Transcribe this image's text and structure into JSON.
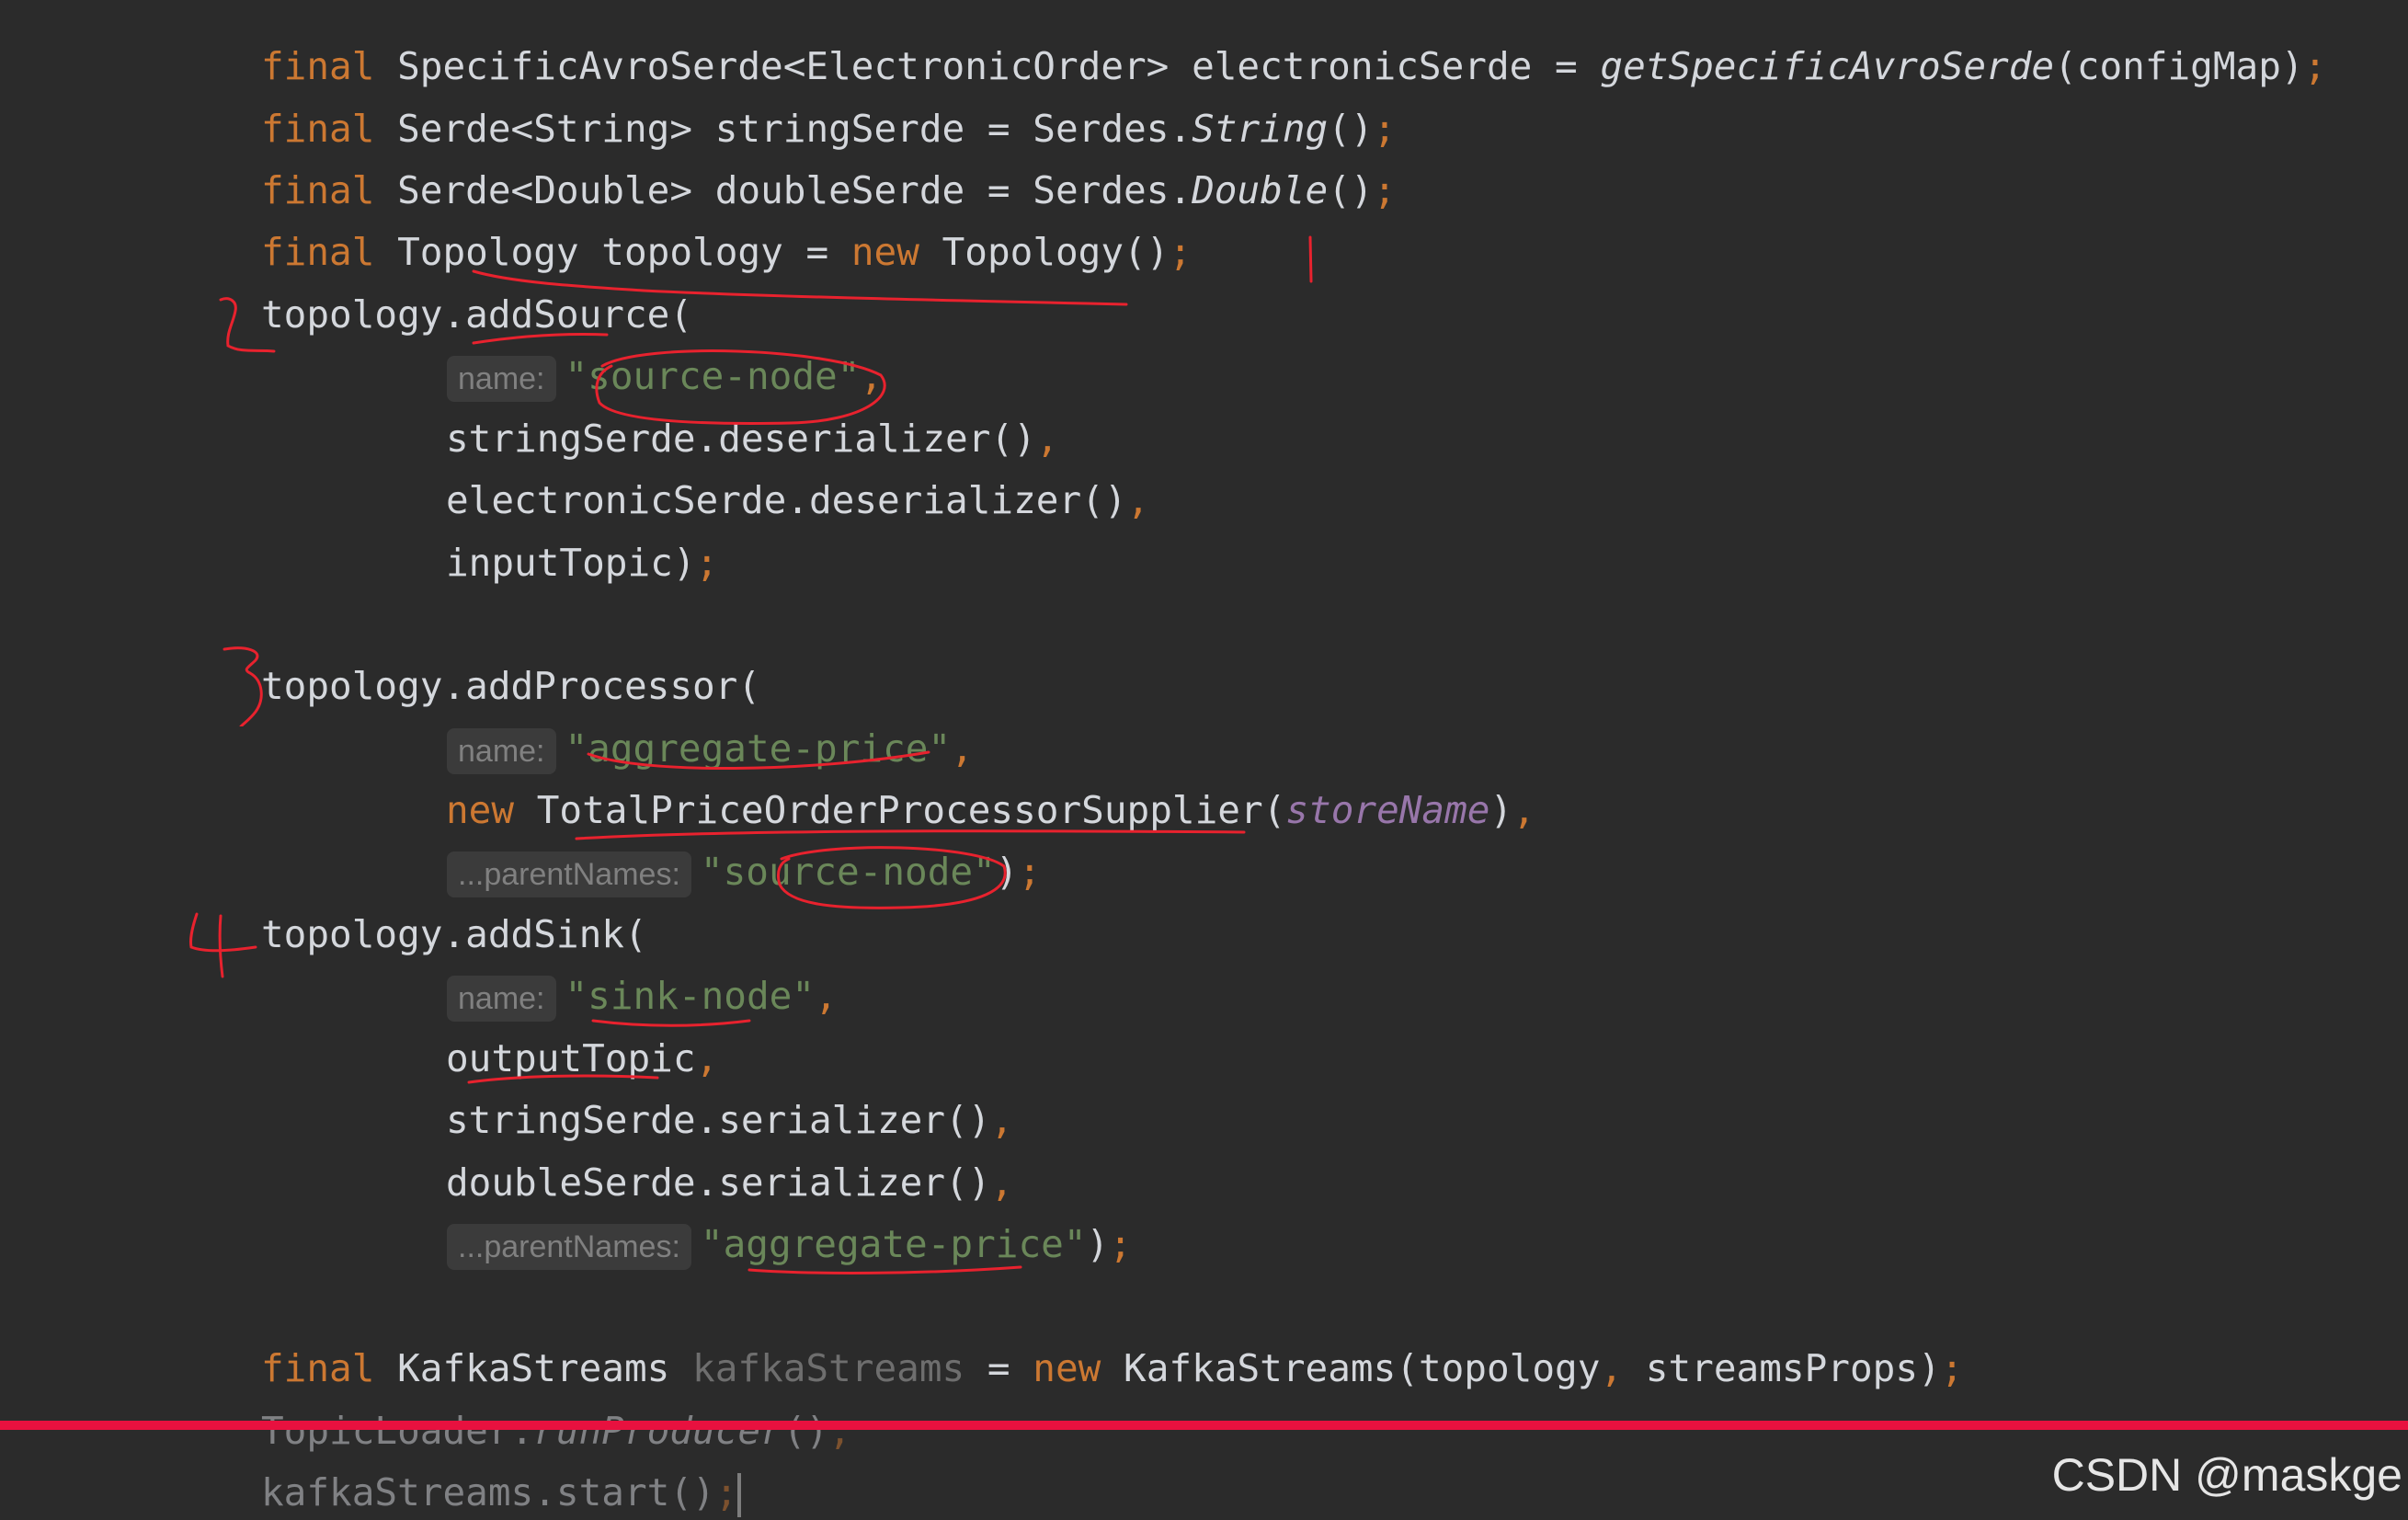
{
  "code": {
    "l1": {
      "kw": "final",
      "type": "SpecificAvroSerde<ElectronicOrder>",
      "var": "electronicSerde",
      "eq": "=",
      "call": "getSpecificAvroSerde",
      "args": "(configMap)",
      "end": ";"
    },
    "l2": {
      "kw": "final",
      "type": "Serde<String>",
      "var": "stringSerde",
      "eq": "=",
      "obj": "Serdes.",
      "call": "String",
      "args": "()",
      "end": ";"
    },
    "l3": {
      "kw": "final",
      "type": "Serde<Double>",
      "var": "doubleSerde",
      "eq": "=",
      "obj": "Serdes.",
      "call": "Double",
      "args": "()",
      "end": ";"
    },
    "l4": {
      "kw": "final",
      "type": "Topology",
      "var": "topology",
      "eq": "=",
      "kw2": "new",
      "call": "Topology()",
      "end": ";"
    },
    "l5": {
      "text": "topology.addSource("
    },
    "l6": {
      "hint": "name:",
      "str": "\"source-node\"",
      "end": ","
    },
    "l7": {
      "text": "stringSerde.deserializer()",
      "end": ","
    },
    "l8": {
      "text": "electronicSerde.deserializer()",
      "end": ","
    },
    "l9": {
      "text": "inputTopic)",
      "end": ";"
    },
    "l10": {
      "text": "topology.addProcessor("
    },
    "l11": {
      "hint": "name:",
      "str": "\"aggregate-price\"",
      "end": ","
    },
    "l12": {
      "kw": "new",
      "call": "TotalPriceOrderProcessorSupplier(",
      "field": "storeName",
      "close": ")",
      "end": ","
    },
    "l13": {
      "hint": "...parentNames:",
      "str": "\"source-node\"",
      "close": ")",
      "end": ";"
    },
    "l14": {
      "text": "topology.addSink("
    },
    "l15": {
      "hint": "name:",
      "str": "\"sink-node\"",
      "end": ","
    },
    "l16": {
      "text": "outputTopic",
      "end": ","
    },
    "l17": {
      "text": "stringSerde.serializer()",
      "end": ","
    },
    "l18": {
      "text": "doubleSerde.serializer()",
      "end": ","
    },
    "l19": {
      "hint": "...parentNames:",
      "str": "\"aggregate-price\"",
      "close": ")",
      "end": ";"
    },
    "l20": {
      "kw": "final",
      "type": "KafkaStreams",
      "var": "kafkaStreams",
      "eq": "=",
      "kw2": "new",
      "call": "KafkaStreams(topology",
      "sep": ",",
      "args": "streamsProps)",
      "end": ";"
    },
    "l21": {
      "obj": "TopicLoader.",
      "call": "runProducer",
      "args": "()",
      "end": ";"
    },
    "l22": {
      "text": "kafkaStreams.start()",
      "end": ";"
    }
  },
  "annotations": {
    "numbers": [
      "2",
      "3",
      "4"
    ],
    "pen_color": "#e8222e"
  },
  "watermark": "CSDN @maskge",
  "colors": {
    "background": "#2b2b2b",
    "keyword": "#cc7832",
    "string": "#6a8759",
    "field": "#9876aa",
    "divider": "#e8113f"
  }
}
